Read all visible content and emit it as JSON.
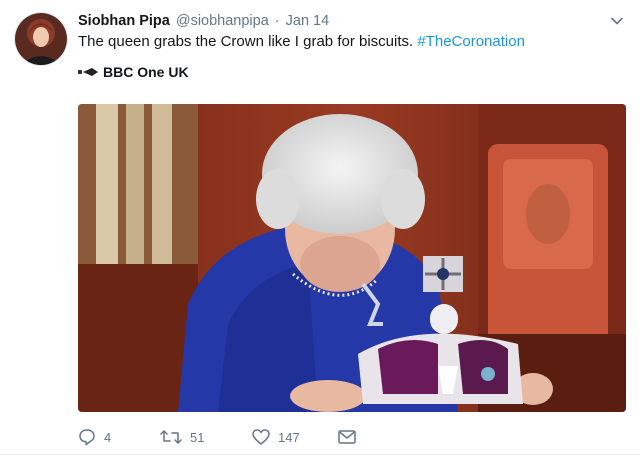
{
  "tweet": {
    "author_name": "Siobhan Pipa",
    "author_handle": "@siobhanpipa",
    "separator": "·",
    "date": "Jan 14",
    "text_before": "The queen grabs the Crown like I grab for biscuits. ",
    "hashtag": "#TheCoronation",
    "source_label": "BBC One UK"
  },
  "actions": {
    "reply_count": "4",
    "retweet_count": "51",
    "like_count": "147"
  },
  "icons": {
    "caret": "chevron-down-icon",
    "source": "bbc-logo-icon",
    "reply": "reply-icon",
    "retweet": "retweet-icon",
    "like": "heart-icon",
    "message": "message-icon"
  },
  "colors": {
    "hashtag": "#1b95e0",
    "muted": "#657786",
    "text": "#14171a"
  }
}
